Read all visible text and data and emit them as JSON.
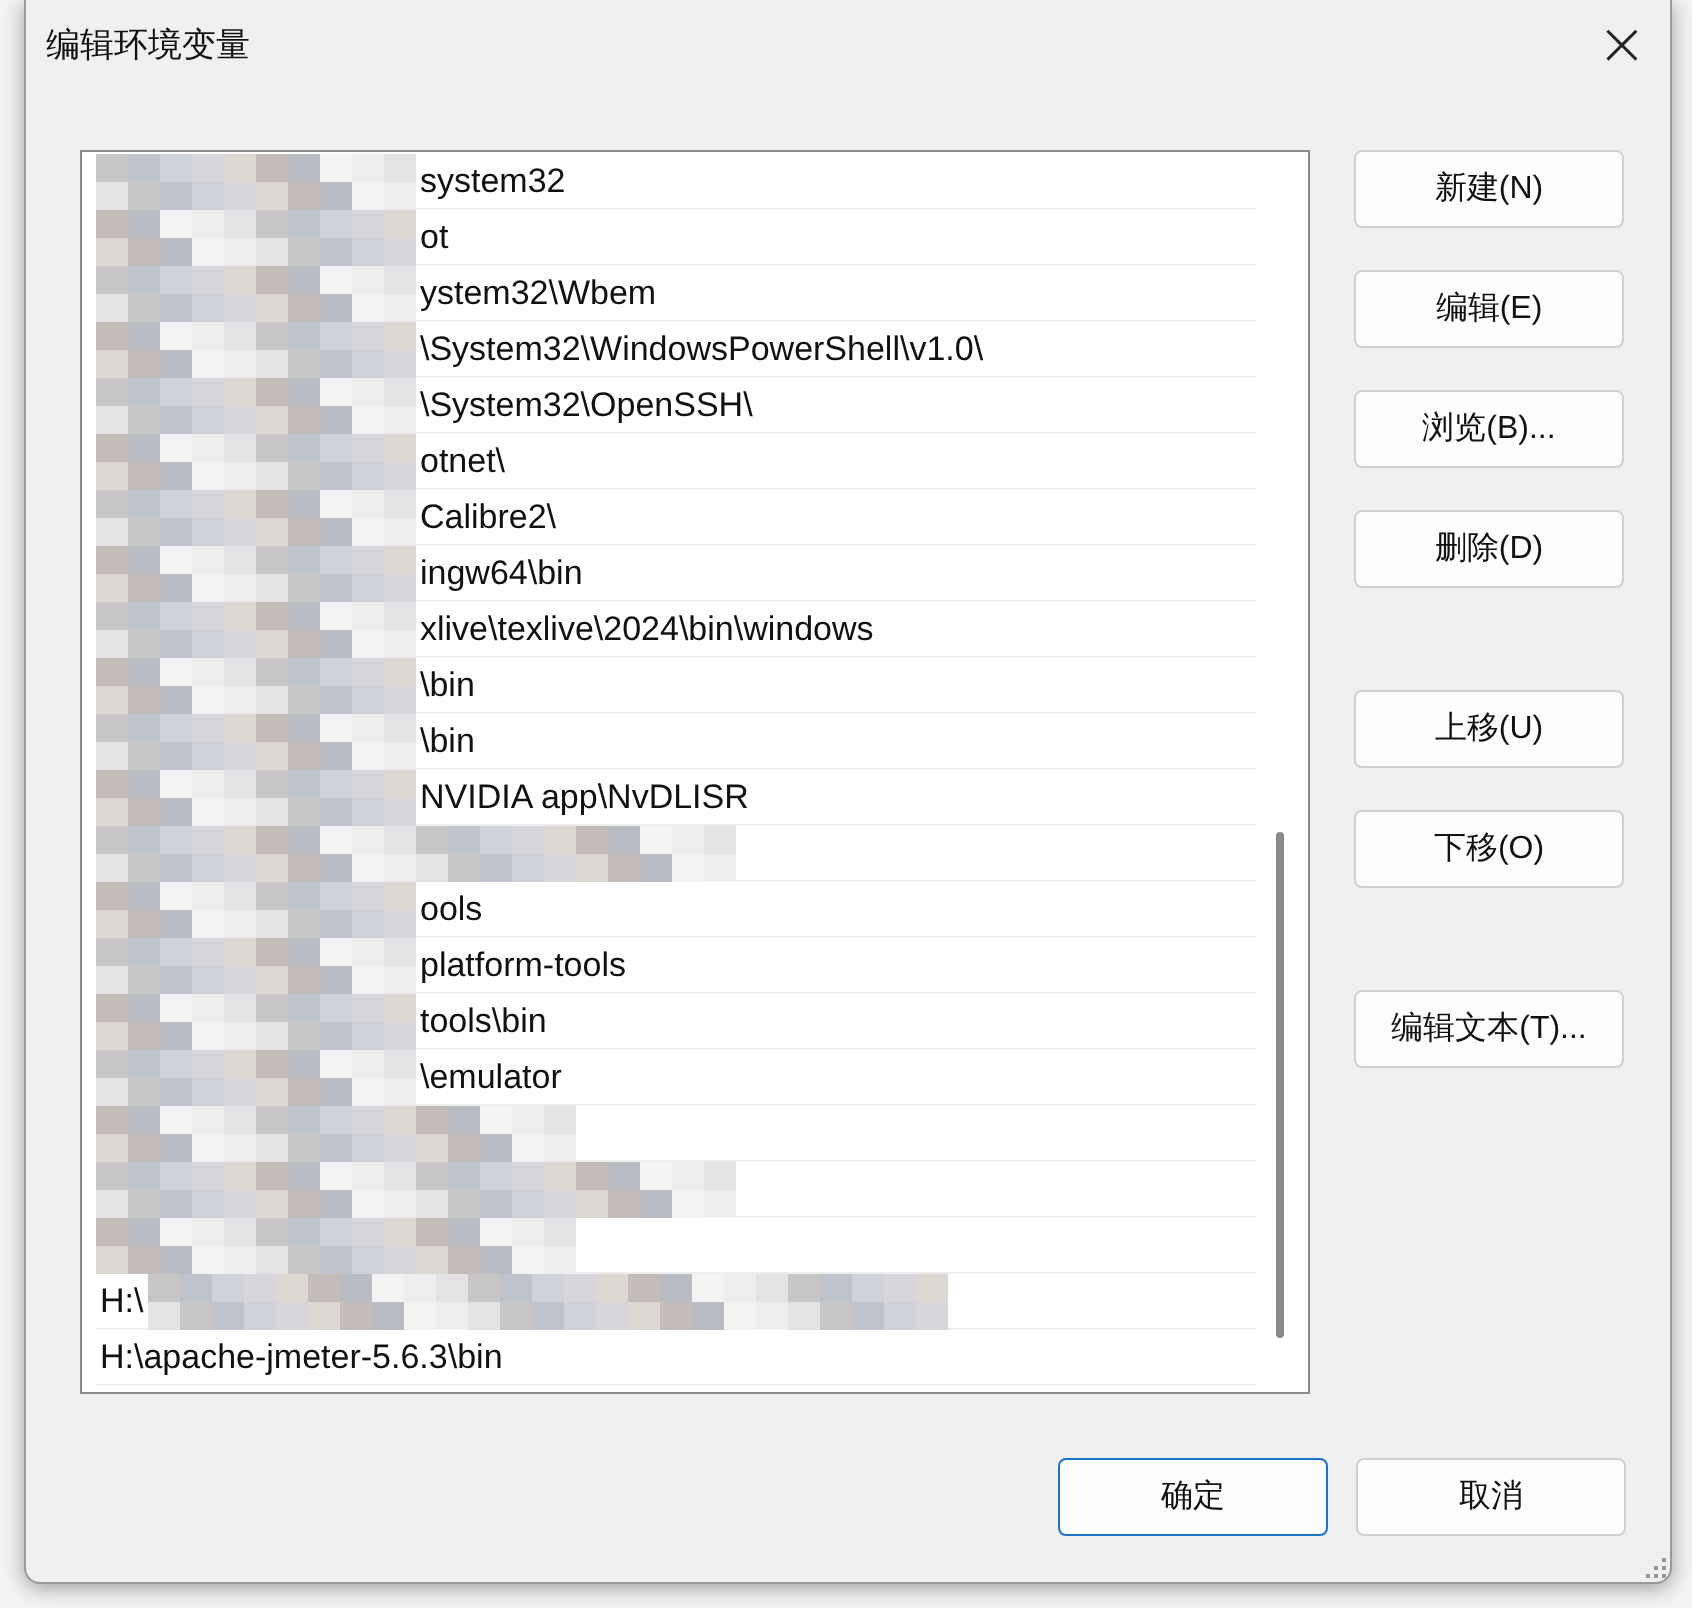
{
  "window": {
    "title": "编辑环境变量",
    "close": "×"
  },
  "path_list": [
    {
      "text": "system32",
      "kind": "masked"
    },
    {
      "text": "ot",
      "kind": "masked"
    },
    {
      "text": "ystem32\\Wbem",
      "kind": "masked"
    },
    {
      "text": "\\System32\\WindowsPowerShell\\v1.0\\",
      "kind": "masked"
    },
    {
      "text": "\\System32\\OpenSSH\\",
      "kind": "masked"
    },
    {
      "text": "otnet\\",
      "kind": "masked"
    },
    {
      "text": "Calibre2\\",
      "kind": "masked"
    },
    {
      "text": "ingw64\\bin",
      "kind": "masked"
    },
    {
      "text": "xlive\\texlive\\2024\\bin\\windows",
      "kind": "masked"
    },
    {
      "text": "\\bin",
      "kind": "masked"
    },
    {
      "text": "\\bin",
      "kind": "masked"
    },
    {
      "text": "NVIDIA app\\NvDLISR",
      "kind": "masked"
    },
    {
      "kind": "hidden"
    },
    {
      "text": "ools",
      "kind": "masked"
    },
    {
      "text": "platform-tools",
      "kind": "masked"
    },
    {
      "text": "tools\\bin",
      "kind": "masked"
    },
    {
      "text": "\\emulator",
      "kind": "masked"
    },
    {
      "kind": "hidden"
    },
    {
      "kind": "hidden"
    },
    {
      "kind": "hidden"
    },
    {
      "text": "H:\\",
      "kind": "tailmasked"
    },
    {
      "text": "H:\\apache-jmeter-5.6.3\\bin",
      "kind": "plain"
    }
  ],
  "side_buttons": [
    {
      "label": "新建(N)",
      "kind": "button"
    },
    {
      "label": "编辑(E)",
      "kind": "button"
    },
    {
      "label": "浏览(B)...",
      "kind": "button"
    },
    {
      "label": "删除(D)",
      "kind": "button"
    },
    {
      "kind": "gap"
    },
    {
      "label": "上移(U)",
      "kind": "button"
    },
    {
      "label": "下移(O)",
      "kind": "button"
    },
    {
      "kind": "gap"
    },
    {
      "label": "编辑文本(T)...",
      "kind": "button"
    }
  ],
  "footer_buttons": [
    {
      "label": "确定",
      "default": true
    },
    {
      "label": "取消",
      "default": false
    }
  ]
}
